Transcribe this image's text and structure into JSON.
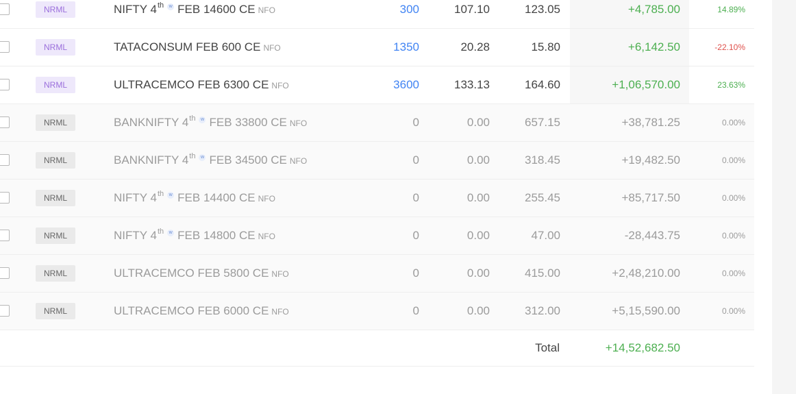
{
  "colors": {
    "positive": "#4caf50",
    "negative": "#df514c",
    "quantity_open": "#4184f3",
    "badge_open_bg": "#eee8fb",
    "badge_open_text": "#9b6fdc"
  },
  "icons": {
    "checkbox": "checkbox-icon",
    "weekly": "weekly-expiry-icon"
  },
  "positions": [
    {
      "product": "NRML",
      "status": "open",
      "symbol": "NIFTY 4",
      "sup": "th",
      "weekly": "w",
      "contract": "FEB 14600 CE",
      "exchange": "NFO",
      "qty": "300",
      "avg": "107.10",
      "ltp": "123.05",
      "pnl": "+4,785.00",
      "pnl_sign": "pos",
      "chg": "14.89%",
      "chg_sign": "pos"
    },
    {
      "product": "NRML",
      "status": "open",
      "symbol": "TATACONSUM FEB 600 CE",
      "sup": "",
      "weekly": "",
      "contract": "",
      "exchange": "NFO",
      "qty": "1350",
      "avg": "20.28",
      "ltp": "15.80",
      "pnl": "+6,142.50",
      "pnl_sign": "pos",
      "chg": "-22.10%",
      "chg_sign": "neg"
    },
    {
      "product": "NRML",
      "status": "open",
      "symbol": "ULTRACEMCO FEB 6300 CE",
      "sup": "",
      "weekly": "",
      "contract": "",
      "exchange": "NFO",
      "qty": "3600",
      "avg": "133.13",
      "ltp": "164.60",
      "pnl": "+1,06,570.00",
      "pnl_sign": "pos",
      "chg": "23.63%",
      "chg_sign": "pos"
    },
    {
      "product": "NRML",
      "status": "closed",
      "symbol": "BANKNIFTY 4",
      "sup": "th",
      "weekly": "w",
      "contract": "FEB 33800 CE",
      "exchange": "NFO",
      "qty": "0",
      "avg": "0.00",
      "ltp": "657.15",
      "pnl": "+38,781.25",
      "pnl_sign": "",
      "chg": "0.00%",
      "chg_sign": "neutral"
    },
    {
      "product": "NRML",
      "status": "closed",
      "symbol": "BANKNIFTY 4",
      "sup": "th",
      "weekly": "w",
      "contract": "FEB 34500 CE",
      "exchange": "NFO",
      "qty": "0",
      "avg": "0.00",
      "ltp": "318.45",
      "pnl": "+19,482.50",
      "pnl_sign": "",
      "chg": "0.00%",
      "chg_sign": "neutral"
    },
    {
      "product": "NRML",
      "status": "closed",
      "symbol": "NIFTY 4",
      "sup": "th",
      "weekly": "w",
      "contract": "FEB 14400 CE",
      "exchange": "NFO",
      "qty": "0",
      "avg": "0.00",
      "ltp": "255.45",
      "pnl": "+85,717.50",
      "pnl_sign": "",
      "chg": "0.00%",
      "chg_sign": "neutral"
    },
    {
      "product": "NRML",
      "status": "closed",
      "symbol": "NIFTY 4",
      "sup": "th",
      "weekly": "w",
      "contract": "FEB 14800 CE",
      "exchange": "NFO",
      "qty": "0",
      "avg": "0.00",
      "ltp": "47.00",
      "pnl": "-28,443.75",
      "pnl_sign": "",
      "chg": "0.00%",
      "chg_sign": "neutral"
    },
    {
      "product": "NRML",
      "status": "closed",
      "symbol": "ULTRACEMCO FEB 5800 CE",
      "sup": "",
      "weekly": "",
      "contract": "",
      "exchange": "NFO",
      "qty": "0",
      "avg": "0.00",
      "ltp": "415.00",
      "pnl": "+2,48,210.00",
      "pnl_sign": "",
      "chg": "0.00%",
      "chg_sign": "neutral"
    },
    {
      "product": "NRML",
      "status": "closed",
      "symbol": "ULTRACEMCO FEB 6000 CE",
      "sup": "",
      "weekly": "",
      "contract": "",
      "exchange": "NFO",
      "qty": "0",
      "avg": "0.00",
      "ltp": "312.00",
      "pnl": "+5,15,590.00",
      "pnl_sign": "",
      "chg": "0.00%",
      "chg_sign": "neutral"
    }
  ],
  "total": {
    "label": "Total",
    "value": "+14,52,682.50",
    "sign": "pos"
  }
}
